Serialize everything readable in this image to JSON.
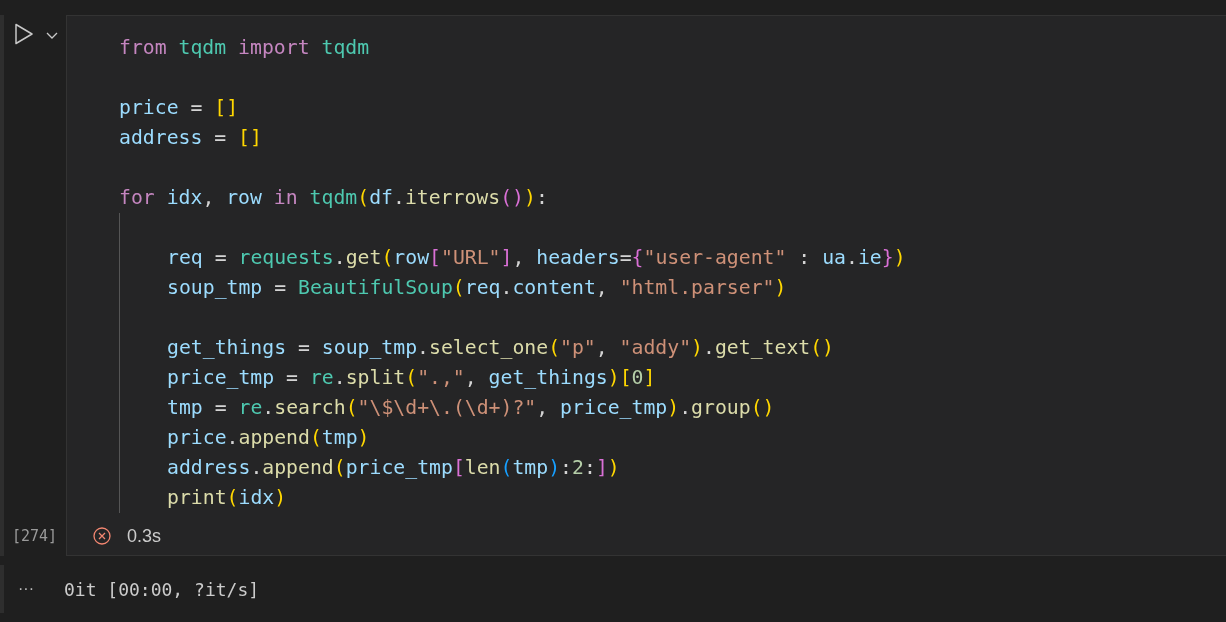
{
  "cell": {
    "lines": [
      {
        "tokens": [
          {
            "kind": "kw",
            "text": "from "
          },
          {
            "kind": "cls",
            "text": "tqdm "
          },
          {
            "kind": "kw",
            "text": "import "
          },
          {
            "kind": "cls",
            "text": "tqdm"
          }
        ]
      },
      {
        "space_before": true,
        "tokens": [
          {
            "kind": "var",
            "text": "price"
          },
          {
            "kind": "p",
            "text": " = "
          },
          {
            "kind": "b1",
            "text": "[]"
          }
        ]
      },
      {
        "tokens": [
          {
            "kind": "var",
            "text": "address"
          },
          {
            "kind": "p",
            "text": " = "
          },
          {
            "kind": "b1",
            "text": "[]"
          }
        ]
      },
      {
        "space_before": true,
        "tokens": [
          {
            "kind": "kw",
            "text": "for "
          },
          {
            "kind": "var",
            "text": "idx"
          },
          {
            "kind": "p",
            "text": ", "
          },
          {
            "kind": "var",
            "text": "row "
          },
          {
            "kind": "kw",
            "text": "in "
          },
          {
            "kind": "cls",
            "text": "tqdm"
          },
          {
            "kind": "b1",
            "text": "("
          },
          {
            "kind": "var",
            "text": "df"
          },
          {
            "kind": "p",
            "text": "."
          },
          {
            "kind": "func",
            "text": "iterrows"
          },
          {
            "kind": "b2",
            "text": "()"
          },
          {
            "kind": "b1",
            "text": ")"
          },
          {
            "kind": "p",
            "text": ":"
          }
        ],
        "children": [
          {
            "space_before": true,
            "tokens": [
              {
                "kind": "var",
                "text": "req"
              },
              {
                "kind": "p",
                "text": " = "
              },
              {
                "kind": "cls",
                "text": "requests"
              },
              {
                "kind": "p",
                "text": "."
              },
              {
                "kind": "func",
                "text": "get"
              },
              {
                "kind": "b1",
                "text": "("
              },
              {
                "kind": "var",
                "text": "row"
              },
              {
                "kind": "b2",
                "text": "["
              },
              {
                "kind": "str",
                "text": "\"URL\""
              },
              {
                "kind": "b2",
                "text": "]"
              },
              {
                "kind": "p",
                "text": ", "
              },
              {
                "kind": "var",
                "text": "headers"
              },
              {
                "kind": "p",
                "text": "="
              },
              {
                "kind": "b2",
                "text": "{"
              },
              {
                "kind": "str",
                "text": "\"user-agent\""
              },
              {
                "kind": "p",
                "text": " : "
              },
              {
                "kind": "var",
                "text": "ua"
              },
              {
                "kind": "p",
                "text": "."
              },
              {
                "kind": "var",
                "text": "ie"
              },
              {
                "kind": "b2",
                "text": "}"
              },
              {
                "kind": "b1",
                "text": ")"
              }
            ]
          },
          {
            "tokens": [
              {
                "kind": "var",
                "text": "soup_tmp"
              },
              {
                "kind": "p",
                "text": " = "
              },
              {
                "kind": "cls",
                "text": "BeautifulSoup"
              },
              {
                "kind": "b1",
                "text": "("
              },
              {
                "kind": "var",
                "text": "req"
              },
              {
                "kind": "p",
                "text": "."
              },
              {
                "kind": "var",
                "text": "content"
              },
              {
                "kind": "p",
                "text": ", "
              },
              {
                "kind": "str",
                "text": "\"html.parser\""
              },
              {
                "kind": "b1",
                "text": ")"
              }
            ]
          },
          {
            "space_before": true,
            "tokens": [
              {
                "kind": "var",
                "text": "get_things"
              },
              {
                "kind": "p",
                "text": " = "
              },
              {
                "kind": "var",
                "text": "soup_tmp"
              },
              {
                "kind": "p",
                "text": "."
              },
              {
                "kind": "func",
                "text": "select_one"
              },
              {
                "kind": "b1",
                "text": "("
              },
              {
                "kind": "str",
                "text": "\"p\""
              },
              {
                "kind": "p",
                "text": ", "
              },
              {
                "kind": "str",
                "text": "\"addy\""
              },
              {
                "kind": "b1",
                "text": ")"
              },
              {
                "kind": "p",
                "text": "."
              },
              {
                "kind": "func",
                "text": "get_text"
              },
              {
                "kind": "b1",
                "text": "()"
              }
            ]
          },
          {
            "tokens": [
              {
                "kind": "var",
                "text": "price_tmp"
              },
              {
                "kind": "p",
                "text": " = "
              },
              {
                "kind": "cls",
                "text": "re"
              },
              {
                "kind": "p",
                "text": "."
              },
              {
                "kind": "func",
                "text": "split"
              },
              {
                "kind": "b1",
                "text": "("
              },
              {
                "kind": "str",
                "text": "\".,\""
              },
              {
                "kind": "p",
                "text": ", "
              },
              {
                "kind": "var",
                "text": "get_things"
              },
              {
                "kind": "b1",
                "text": ")"
              },
              {
                "kind": "b1",
                "text": "["
              },
              {
                "kind": "num",
                "text": "0"
              },
              {
                "kind": "b1",
                "text": "]"
              }
            ]
          },
          {
            "tokens": [
              {
                "kind": "var",
                "text": "tmp"
              },
              {
                "kind": "p",
                "text": " = "
              },
              {
                "kind": "cls",
                "text": "re"
              },
              {
                "kind": "p",
                "text": "."
              },
              {
                "kind": "func",
                "text": "search"
              },
              {
                "kind": "b1",
                "text": "("
              },
              {
                "kind": "str",
                "text": "\"\\$\\d+\\.(\\d+)?\""
              },
              {
                "kind": "p",
                "text": ", "
              },
              {
                "kind": "var",
                "text": "price_tmp"
              },
              {
                "kind": "b1",
                "text": ")"
              },
              {
                "kind": "p",
                "text": "."
              },
              {
                "kind": "func",
                "text": "group"
              },
              {
                "kind": "b1",
                "text": "()"
              }
            ]
          },
          {
            "tokens": [
              {
                "kind": "var",
                "text": "price"
              },
              {
                "kind": "p",
                "text": "."
              },
              {
                "kind": "func",
                "text": "append"
              },
              {
                "kind": "b1",
                "text": "("
              },
              {
                "kind": "var",
                "text": "tmp"
              },
              {
                "kind": "b1",
                "text": ")"
              }
            ]
          },
          {
            "tokens": [
              {
                "kind": "var",
                "text": "address"
              },
              {
                "kind": "p",
                "text": "."
              },
              {
                "kind": "func",
                "text": "append"
              },
              {
                "kind": "b1",
                "text": "("
              },
              {
                "kind": "var",
                "text": "price_tmp"
              },
              {
                "kind": "b2",
                "text": "["
              },
              {
                "kind": "func",
                "text": "len"
              },
              {
                "kind": "b3",
                "text": "("
              },
              {
                "kind": "var",
                "text": "tmp"
              },
              {
                "kind": "b3",
                "text": ")"
              },
              {
                "kind": "p",
                "text": ":"
              },
              {
                "kind": "num",
                "text": "2"
              },
              {
                "kind": "p",
                "text": ":"
              },
              {
                "kind": "b2",
                "text": "]"
              },
              {
                "kind": "b1",
                "text": ")"
              }
            ]
          },
          {
            "tokens": [
              {
                "kind": "func",
                "text": "print"
              },
              {
                "kind": "b1",
                "text": "("
              },
              {
                "kind": "var",
                "text": "idx"
              },
              {
                "kind": "b1",
                "text": ")"
              }
            ]
          }
        ]
      }
    ],
    "execution_count": "[274]",
    "status": {
      "kind": "error",
      "duration": "0.3s"
    }
  },
  "output": {
    "more": "···",
    "text": "0it [00:00, ?it/s]"
  }
}
